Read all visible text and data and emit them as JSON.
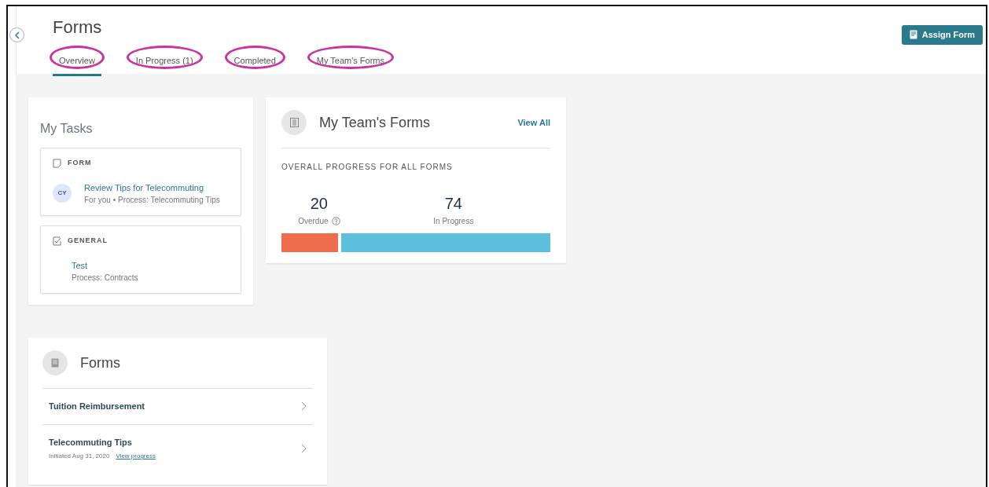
{
  "header": {
    "title": "Forms",
    "assign_button": "Assign Form"
  },
  "tabs": [
    {
      "label": "Overview",
      "selected": true,
      "circled": true
    },
    {
      "label": "In Progress (1)",
      "selected": false,
      "circled": true
    },
    {
      "label": "Completed",
      "selected": false,
      "circled": true
    },
    {
      "label": "My Team's Forms",
      "selected": false,
      "circled": true
    }
  ],
  "my_tasks": {
    "title": "My Tasks",
    "tasks": [
      {
        "kind": "form",
        "category": "FORM",
        "avatar": "CY",
        "title": "Review Tips for Telecommuting",
        "subtitle": "For you • Process: Telecommuting Tips"
      },
      {
        "kind": "general",
        "category": "GENERAL",
        "title": "Test",
        "subtitle": "Process: Contracts"
      }
    ]
  },
  "team_forms": {
    "title": "My Team's Forms",
    "view_all": "View All",
    "section": "OVERALL PROGRESS FOR ALL FORMS",
    "stats": [
      {
        "value": "20",
        "label": "Overdue",
        "info": true,
        "color": "#ef6c4c"
      },
      {
        "value": "74",
        "label": "In Progress",
        "info": false,
        "color": "#5cbfdb"
      }
    ]
  },
  "forms": {
    "title": "Forms",
    "items": [
      {
        "name": "Tuition Reimbursement"
      },
      {
        "name": "Telecommuting Tips",
        "initiated": "Initiated Aug 31, 2020",
        "link": "View progress"
      }
    ]
  }
}
